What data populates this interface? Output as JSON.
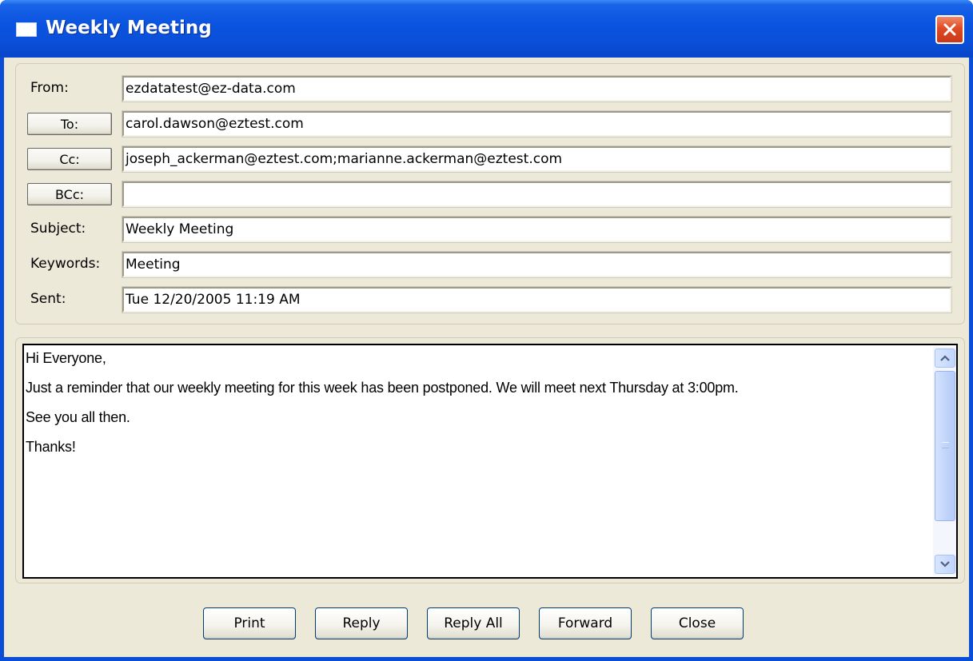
{
  "window": {
    "title": "Weekly Meeting",
    "icons": {
      "app": "envelope-icon",
      "close": "close-icon"
    }
  },
  "headers": {
    "from": {
      "label": "From:",
      "value": "ezdatatest@ez-data.com"
    },
    "to": {
      "label": "To:",
      "value": "carol.dawson@eztest.com"
    },
    "cc": {
      "label": "Cc:",
      "value": "joseph_ackerman@eztest.com;marianne.ackerman@eztest.com"
    },
    "bcc": {
      "label": "BCc:",
      "value": ""
    },
    "subject": {
      "label": "Subject:",
      "value": "Weekly Meeting"
    },
    "keywords": {
      "label": "Keywords:",
      "value": "Meeting"
    },
    "sent": {
      "label": "Sent:",
      "value": "Tue  12/20/2005 11:19 AM"
    }
  },
  "message": {
    "lines": [
      "Hi Everyone,",
      "Just a reminder that our weekly meeting for this week has been postponed. We will meet next Thursday at 3:00pm.",
      "See you all then.",
      "Thanks!"
    ]
  },
  "buttons": {
    "print": "Print",
    "reply": "Reply",
    "reply_all": "Reply All",
    "forward": "Forward",
    "close": "Close"
  },
  "colors": {
    "title_bar": "#0a54e0",
    "dialog_face": "#ece9d8",
    "close_button": "#e04b24",
    "scrollbar": "#c1d4fb"
  }
}
